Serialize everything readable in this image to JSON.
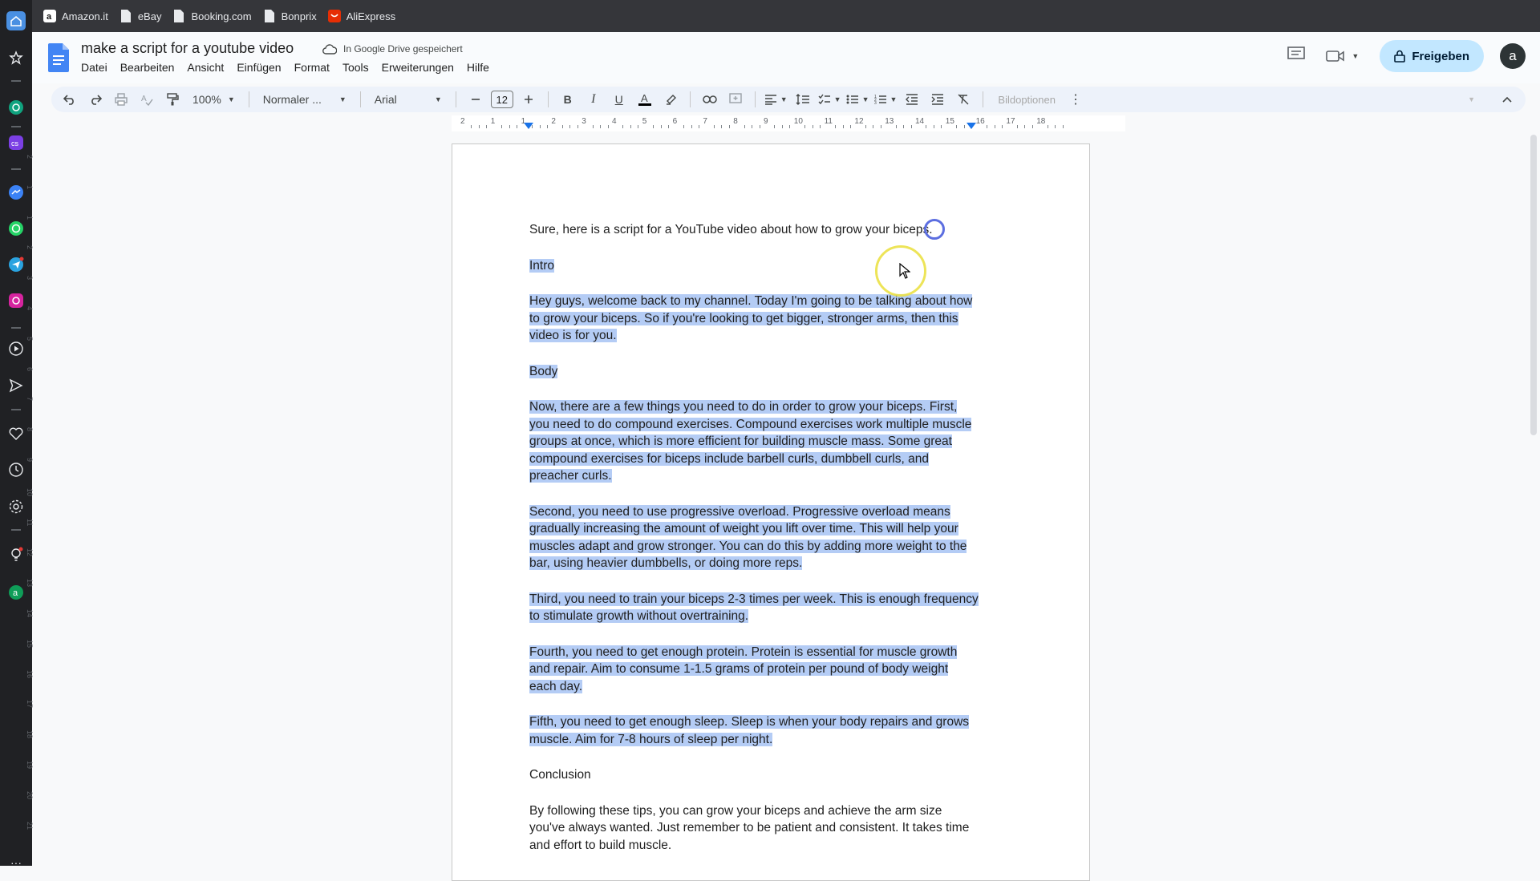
{
  "bookmarks": [
    {
      "label": "Amazon.it",
      "icon": "amazon-icon"
    },
    {
      "label": "eBay",
      "icon": "doc-icon"
    },
    {
      "label": "Booking.com",
      "icon": "doc-icon"
    },
    {
      "label": "Bonprix",
      "icon": "doc-icon"
    },
    {
      "label": "AliExpress",
      "icon": "aliexpress-icon"
    }
  ],
  "doc": {
    "title": "make a script for a youtube video",
    "save_status": "In Google Drive gespeichert"
  },
  "menu": [
    "Datei",
    "Bearbeiten",
    "Ansicht",
    "Einfügen",
    "Format",
    "Tools",
    "Erweiterungen",
    "Hilfe"
  ],
  "header": {
    "share_label": "Freigeben",
    "avatar_letter": "a"
  },
  "toolbar": {
    "zoom": "100%",
    "style": "Normaler ...",
    "font": "Arial",
    "font_size": "12",
    "image_options": "Bildoptionen"
  },
  "ruler": {
    "labels": [
      "2",
      "1",
      "1",
      "2",
      "3",
      "4",
      "5",
      "6",
      "7",
      "8",
      "9",
      "10",
      "11",
      "12",
      "13",
      "14",
      "15",
      "16",
      "17",
      "18"
    ]
  },
  "vruler": {
    "labels": [
      "2",
      "1",
      "1",
      "2",
      "3",
      "4",
      "5",
      "6",
      "7",
      "8",
      "9",
      "10",
      "11",
      "12",
      "13",
      "14",
      "15",
      "16",
      "17",
      "18",
      "19",
      "20",
      "21"
    ]
  },
  "content": {
    "intro_line": "Sure, here is a script for a YouTube video about how to grow your biceps.",
    "h_intro": "Intro",
    "intro_p": "Hey guys, welcome back to my channel. Today I'm going to be talking about how to grow your biceps. So if you're looking to get bigger, stronger arms, then this video is for you.",
    "h_body": "Body",
    "body_p1": "Now, there are a few things you need to do in order to grow your biceps. First, you need to do compound exercises. Compound exercises work multiple muscle groups at once, which is more efficient for building muscle mass. Some great compound exercises for biceps include barbell curls, dumbbell curls, and preacher curls.",
    "body_p2": "Second, you need to use progressive overload. Progressive overload means gradually increasing the amount of weight you lift over time. This will help your muscles adapt and grow stronger. You can do this by adding more weight to the bar, using heavier dumbbells, or doing more reps.",
    "body_p3": "Third, you need to train your biceps 2-3 times per week. This is enough frequency to stimulate growth without overtraining.",
    "body_p4": "Fourth, you need to get enough protein. Protein is essential for muscle growth and repair. Aim to consume 1-1.5 grams of protein per pound of body weight each day.",
    "body_p5": "Fifth, you need to get enough sleep. Sleep is when your body repairs and grows muscle. Aim for 7-8 hours of sleep per night.",
    "h_conclusion": "Conclusion",
    "conclusion_p": "By following these tips, you can grow your biceps and achieve the arm size you've always wanted. Just remember to be patient and consistent. It takes time and effort to build muscle."
  },
  "colors": {
    "selection": "#b4ccf5",
    "share_bg": "#c2e7ff",
    "sidebar_bg": "#202124",
    "bookmarks_bg": "#35363a"
  }
}
